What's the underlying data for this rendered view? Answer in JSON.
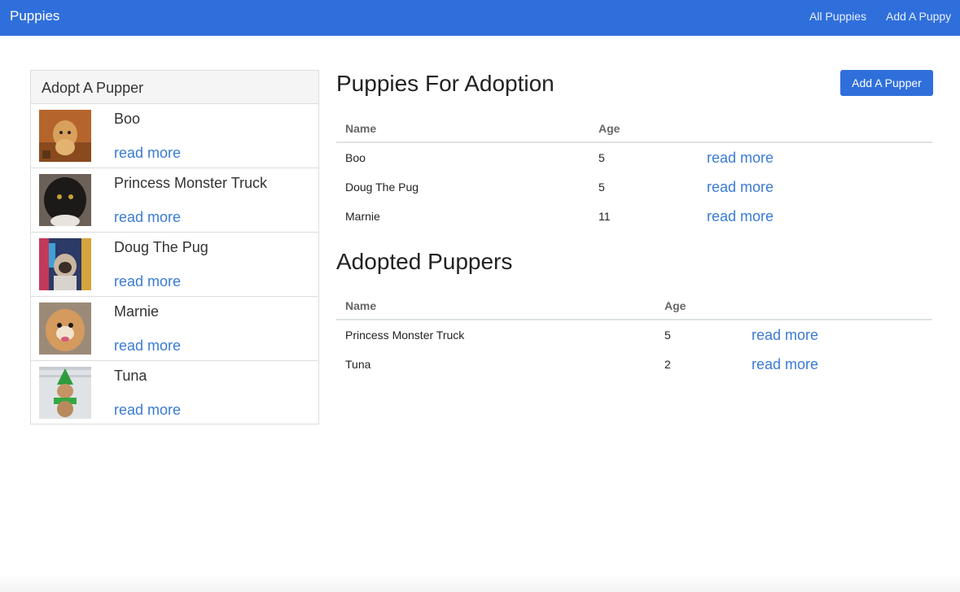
{
  "navbar": {
    "brand": "Puppies",
    "links": [
      "All Puppies",
      "Add A Puppy"
    ]
  },
  "sidebar": {
    "title": "Adopt A Pupper",
    "items": [
      {
        "name": "Boo",
        "link": "read more"
      },
      {
        "name": "Princess Monster Truck",
        "link": "read more"
      },
      {
        "name": "Doug The Pug",
        "link": "read more"
      },
      {
        "name": "Marnie",
        "link": "read more"
      },
      {
        "name": "Tuna",
        "link": "read more"
      }
    ]
  },
  "adoption": {
    "title": "Puppies For Adoption",
    "button": "Add A Pupper",
    "columns": [
      "Name",
      "Age"
    ],
    "rows": [
      {
        "name": "Boo",
        "age": "5",
        "link": "read more"
      },
      {
        "name": "Doug The Pug",
        "age": "5",
        "link": "read more"
      },
      {
        "name": "Marnie",
        "age": "11",
        "link": "read more"
      }
    ]
  },
  "adopted": {
    "title": "Adopted Puppers",
    "columns": [
      "Name",
      "Age"
    ],
    "rows": [
      {
        "name": "Princess Monster Truck",
        "age": "5",
        "link": "read more"
      },
      {
        "name": "Tuna",
        "age": "2",
        "link": "read more"
      }
    ]
  },
  "colors": {
    "navbar": "#2f6fdb",
    "link": "#3a7bd5",
    "button": "#2f6fdb"
  }
}
